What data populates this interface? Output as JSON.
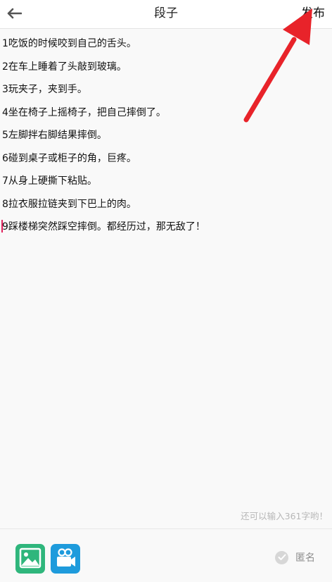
{
  "header": {
    "title": "段子",
    "publish_label": "发布"
  },
  "editor": {
    "lines": [
      "1吃饭的时候咬到自己的舌头。",
      "2在车上睡着了头敲到玻璃。",
      "3玩夹子，夹到手。",
      "4坐在椅子上摇椅子，把自己摔倒了。",
      "5左脚拌右脚结果摔倒。",
      "6碰到桌子或柜子的角，巨疼。",
      "7从身上硬撕下粘贴。",
      "8拉衣服拉链夹到下巴上的肉。",
      "9踩楼梯突然踩空摔倒。都经历过，那无敌了！"
    ],
    "char_counter": "还可以输入361字哟！"
  },
  "toolbar": {
    "anonymous_label": "匿名"
  },
  "colors": {
    "arrow": "#e8232a",
    "image_icon": "#2fb67c",
    "video_icon": "#1e9bdc",
    "caret": "#e0245e"
  },
  "icons": [
    "back-arrow-icon",
    "image-icon",
    "video-camera-icon",
    "check-icon"
  ]
}
